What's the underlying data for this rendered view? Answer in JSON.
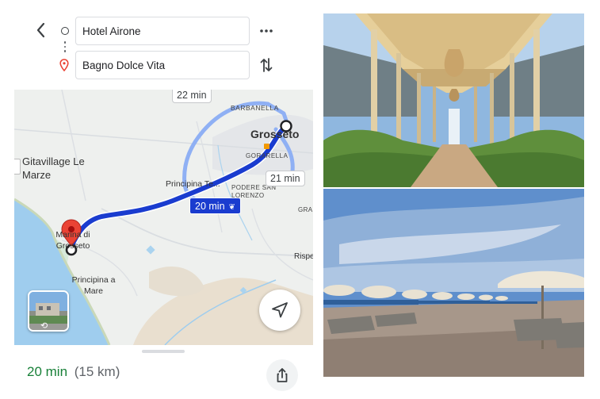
{
  "directions": {
    "origin": "Hotel Airone",
    "destination": "Bagno Dolce Vita"
  },
  "icons": {
    "back": "back-arrow-icon",
    "origin": "origin-circle-icon",
    "destination": "destination-pin-icon",
    "more": "more-dots-icon",
    "swap": "swap-arrows-icon",
    "locate": "navigation-arrow-icon",
    "share": "share-icon",
    "rotate": "rotate-360-icon",
    "eco": "eco-leaf-icon"
  },
  "map": {
    "labels": {
      "barbanella": "BARBANELLA",
      "grosseto": "Grosseto",
      "gorarella": "GORARELLA",
      "gitavillage": "Gitavillage Le Marze",
      "principina_terra": "Principina Te...",
      "podere": "PODERE SAN LORENZO",
      "gra": "GRA",
      "marina": "Marina di Grosseto",
      "rispescia": "Rispe",
      "principina_mare": "Principina a Mare"
    },
    "routes": {
      "alt1_time": "22 min",
      "alt2_time": "21 min",
      "main_time": "20 min"
    },
    "colors": {
      "main_route": "#1a3ccf",
      "alt_route": "#8fb0f4",
      "sea": "#9fcdee",
      "destination_pin": "#ea4335"
    }
  },
  "summary": {
    "time": "20 min",
    "distance": "(15 km)"
  }
}
